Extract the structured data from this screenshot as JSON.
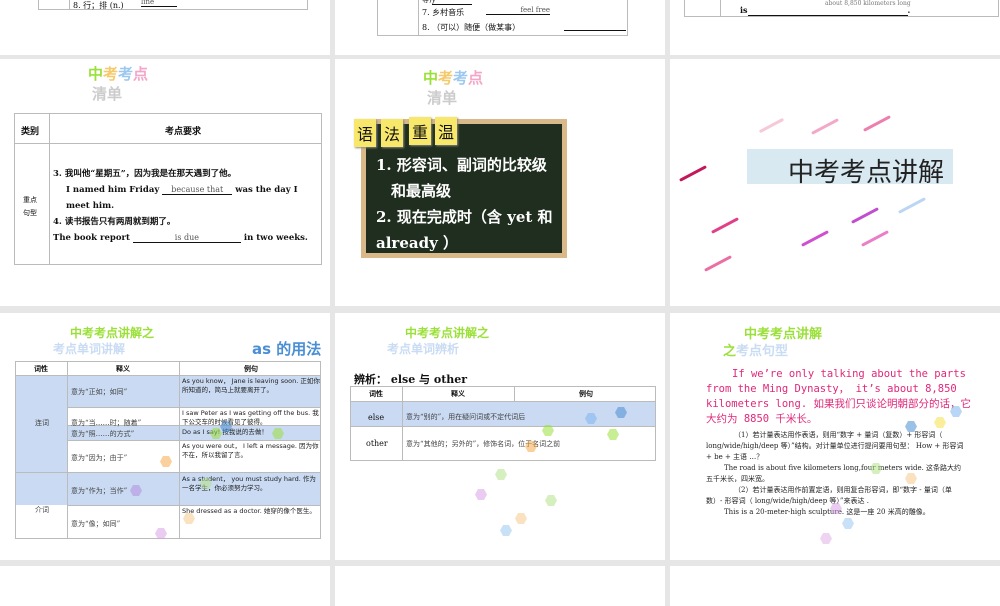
{
  "row1": {
    "s1": {
      "line": "8.  行；排 (n.)",
      "answer": "line"
    },
    "s2": {
      "partial": "等)",
      "partial_answer": "y",
      "line7": "7.  乡村音乐",
      "answer7": "feel free",
      "line8": "8. （可以）随便（做某事）"
    },
    "s3": {
      "line": "is",
      "end": ".",
      "partial": "about 8,850 kilometers long"
    }
  },
  "slide_list": {
    "title_a": "中考考点",
    "title_b": "清单",
    "table": {
      "h1": "类别",
      "h2": "考点要求",
      "cat": "重点句型",
      "l1": "3.  我叫他“星期五”，因为我是在那天遇到了他。",
      "l2a": "I named him Friday",
      "a1": "because that",
      "l2b": "was the day I",
      "l3": "meet him.",
      "l4": "4. 读书报告只有两周就到期了。",
      "l5a": "The book report",
      "a2": "is due",
      "l5b": "in two weeks."
    }
  },
  "slide_grammar": {
    "title_a": "中考考点",
    "title_b": "清单",
    "notes": [
      "语",
      "法",
      "重",
      "温"
    ],
    "items": [
      "1.  形容词、副词的比较级",
      "和最高级",
      "2. 现在完成时（含 yet 和",
      "already ）"
    ]
  },
  "slide_section": {
    "title": "中考考点讲解"
  },
  "slide_as": {
    "title_a": "中考考点讲解之",
    "title_b": "考点单词讲解",
    "heading": "as 的用法",
    "headers": [
      "词性",
      "释义",
      "例句"
    ],
    "groups": [
      {
        "pos": "连词",
        "rows": [
          {
            "meaning": "意为“正如；如同”",
            "example": "As you know， Jane is leaving soon. 正如你所知道的，简马上就要离开了。"
          },
          {
            "meaning": "意为“当……时；随着”",
            "example": "I saw Peter as I was getting off the bus. 我下公交车的时候看见了彼得。"
          },
          {
            "meaning": "意为“照……的方式”",
            "example": "Do as I say! 按我说的去做！"
          },
          {
            "meaning": "意为“因为；由于”",
            "example": "As you were out， I left  a message. 因为你不在，所以我留了言。"
          }
        ]
      },
      {
        "pos": "介词",
        "rows": [
          {
            "meaning": "意为“作为；当作”",
            "example": "As a student， you must study hard. 作为一名学生，你必须努力学习。"
          },
          {
            "meaning": "意为“像；如同”",
            "example": "She dressed as a doctor. 她穿的像个医生。"
          }
        ]
      }
    ]
  },
  "slide_else": {
    "title_a": "中考考点讲解之",
    "title_b": "考点单词辨析",
    "heading": "辨析：  else  与 other",
    "headers": [
      "词性",
      "释义",
      "例句"
    ],
    "rows": [
      {
        "pos": "else",
        "meaning": "意为“别的”，用在疑问词或不定代词后"
      },
      {
        "pos": "other",
        "meaning": "意为“其他的；另外的”，修饰名词，位于名词之前"
      }
    ]
  },
  "slide_sentence": {
    "title_a": "中考考点讲解",
    "title_b1": "之",
    "title_b2": "考点句型",
    "highlight": "If we’re only talking about the parts from the Ming Dynasty， it’s about 8,850 kilometers long. 如果我们只谈论明朝部分的话，它大约为 8850 千米长。",
    "p1": "（1）若计量表达用作表语，则用“数字 + 量词（复数）+ 形容词（ long/wide/high/deep 等）”结构。对计量单位进行提问要用句型： How +  形容词  + be + 主语 …？",
    "p2": "The road is about five kilometers long,four meters wide. 这条路大约五千米长，四米宽。",
    "p3": "（2）若计量表达用作前置定语，则用复合形容词，即“数字 - 量词（单数）- 形容词（ long/wide/high/deep 等）”来表达 .",
    "p4": "This is a 20-meter-high sculpture. 这是一座 20 米高的雕像。"
  }
}
